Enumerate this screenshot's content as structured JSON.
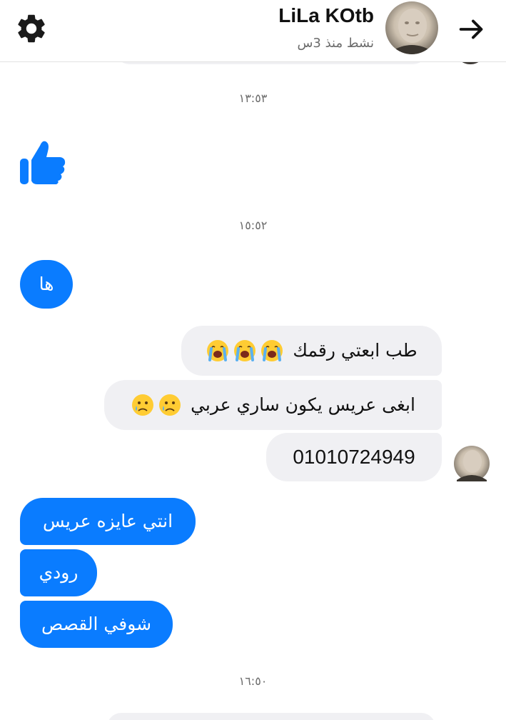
{
  "header": {
    "name": "LiLa KOtb",
    "status": "نشط منذ 3س",
    "icons": {
      "settings": "gear-icon",
      "back": "arrow-right-icon",
      "avatar": "profile-avatar"
    }
  },
  "colors": {
    "sent_bubble": "#0a7cff",
    "received_bubble": "#f0f0f3",
    "timestamp": "#6b6b6b"
  },
  "timestamps": [
    "١٣:٥٣",
    "١٥:٥٢",
    "١٦:٥٠"
  ],
  "messages": [
    {
      "side": "sent",
      "type": "like",
      "icon": "thumbs-up-icon"
    },
    {
      "side": "sent",
      "text": "ها"
    },
    {
      "side": "received",
      "text": "طب ابعتي رقمك",
      "emoji": "loudly-crying-face",
      "emoji_count": 3
    },
    {
      "side": "received",
      "text": "ابغى عريس يكون ساري عربي",
      "emoji": "sad-tear-face",
      "emoji_count": 2
    },
    {
      "side": "received",
      "text": "01010724949"
    },
    {
      "side": "sent",
      "text": "انتي عايزه عريس"
    },
    {
      "side": "sent",
      "text": "رودي"
    },
    {
      "side": "sent",
      "text": "شوفي القصص"
    }
  ]
}
